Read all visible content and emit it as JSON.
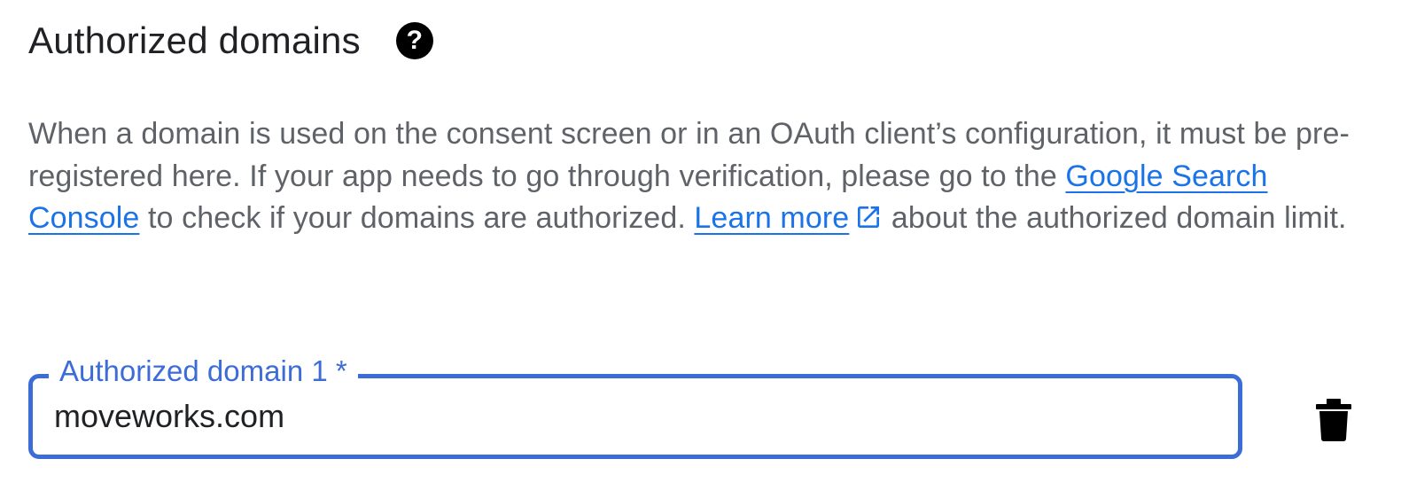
{
  "section": {
    "title": "Authorized domains",
    "help_icon": "help-circle-icon"
  },
  "description": {
    "text_1": "When a domain is used on the consent screen or in an OAuth client’s configuration, it must be pre-registered here. If your app needs to go through verification, please go to the ",
    "link_search_console": "Google Search Console",
    "text_2": " to check if your domains are authorized. ",
    "link_learn_more": "Learn more",
    "external_icon": "open-in-new-icon",
    "text_3": " about the authorized domain limit."
  },
  "domain_field": {
    "label": "Authorized domain 1 *",
    "value": "moveworks.com",
    "accent_color": "#3c6cd6",
    "delete_icon": "trash-icon"
  },
  "colors": {
    "link": "#1a73e8",
    "body_text": "#5f6368",
    "title_text": "#202124"
  }
}
